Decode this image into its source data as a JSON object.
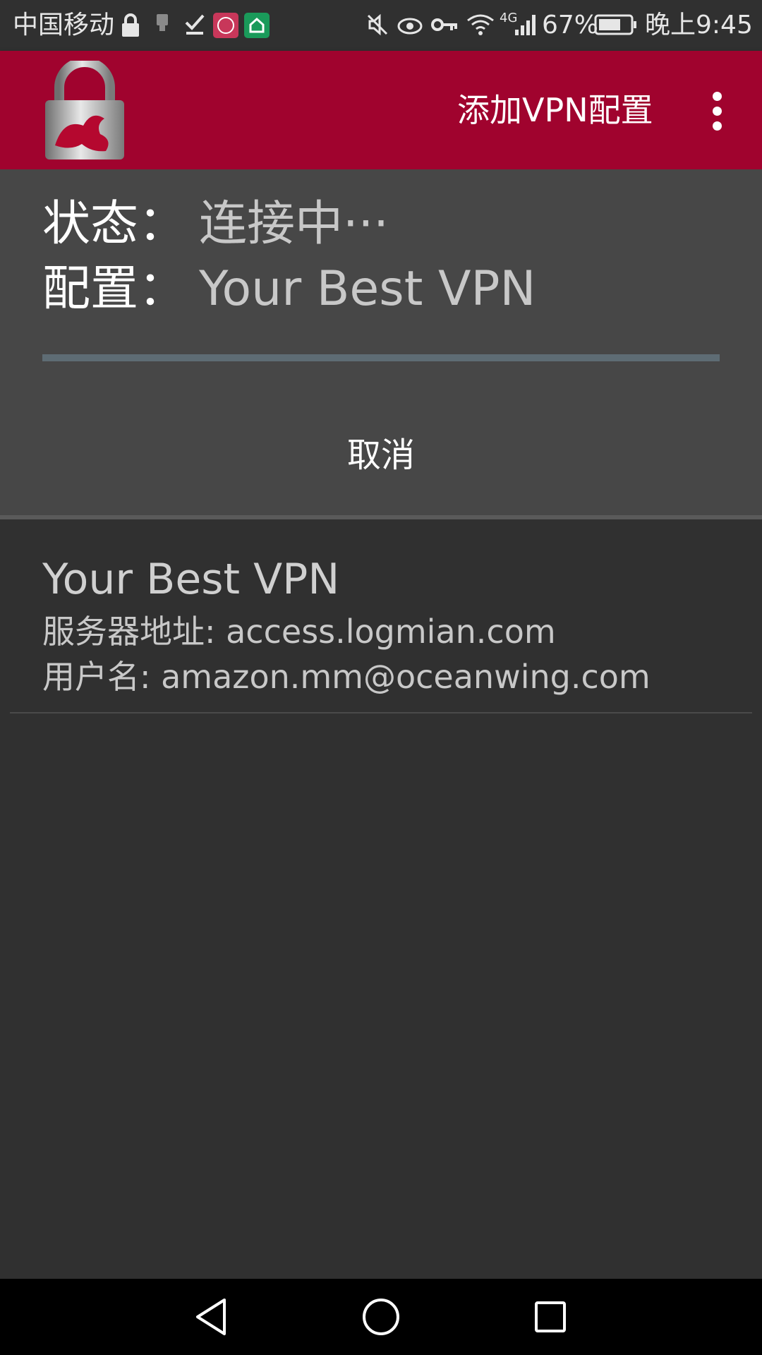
{
  "status_bar": {
    "carrier": "中国移动",
    "battery": "67%",
    "network": "4G",
    "time": "晚上9:45"
  },
  "app_bar": {
    "action_label": "添加VPN配置",
    "icon": "strongswan-lock-logo"
  },
  "status_panel": {
    "status_label": "状态：",
    "status_value": "连接中···",
    "profile_label": "配置：",
    "profile_value": "Your Best VPN",
    "cancel_label": "取消"
  },
  "profiles": [
    {
      "name": "Your Best VPN",
      "server": "服务器地址: access.logmian.com",
      "user": "用户名: amazon.mm@oceanwing.com"
    }
  ],
  "colors": {
    "app_bar": "#a0032e",
    "panel": "#474747",
    "background": "#303030",
    "progress": "#5e6c74"
  }
}
